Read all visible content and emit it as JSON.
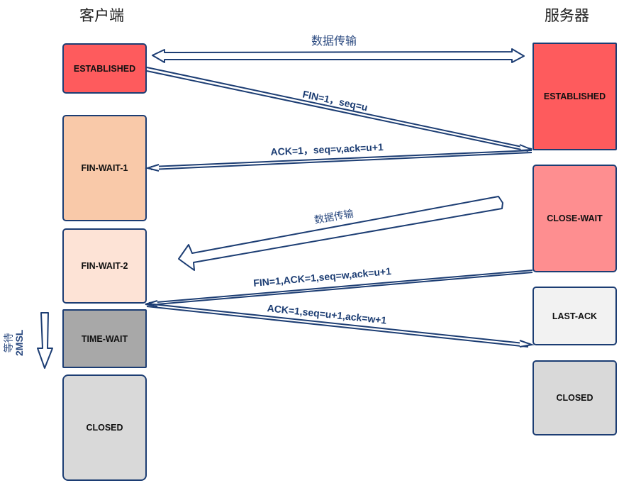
{
  "columns": {
    "client_title": "客户端",
    "server_title": "服务器"
  },
  "client_states": [
    {
      "label": "ESTABLISHED",
      "color": "#fe5b5d"
    },
    {
      "label": "FIN-WAIT-1",
      "color": "#f9c9a9"
    },
    {
      "label": "FIN-WAIT-2",
      "color": "#fde3d6"
    },
    {
      "label": "TIME-WAIT",
      "color": "#a8a8a8"
    },
    {
      "label": "CLOSED",
      "color": "#d9d9d9"
    }
  ],
  "server_states": [
    {
      "label": "ESTABLISHED",
      "color": "#fe5b5d"
    },
    {
      "label": "CLOSE-WAIT",
      "color": "#fe8e90"
    },
    {
      "label": "LAST-ACK",
      "color": "#f2f2f2"
    },
    {
      "label": "CLOSED",
      "color": "#d9d9d9"
    }
  ],
  "messages": {
    "data_transfer_both": "数据传输",
    "fin1": "FIN=1，seq=u",
    "ack1": "ACK=1，seq=v,ack=u+1",
    "data_transfer_server": "数据传输",
    "fin2": "FIN=1,ACK=1,seq=w,ack=u+1",
    "ack2": "ACK=1,seq=u+1,ack=w+1"
  },
  "time_wait_note": {
    "line1": "等待",
    "line2": "2MSL"
  },
  "colors": {
    "stroke": "#1c3d73",
    "text": "#1c3d73"
  }
}
